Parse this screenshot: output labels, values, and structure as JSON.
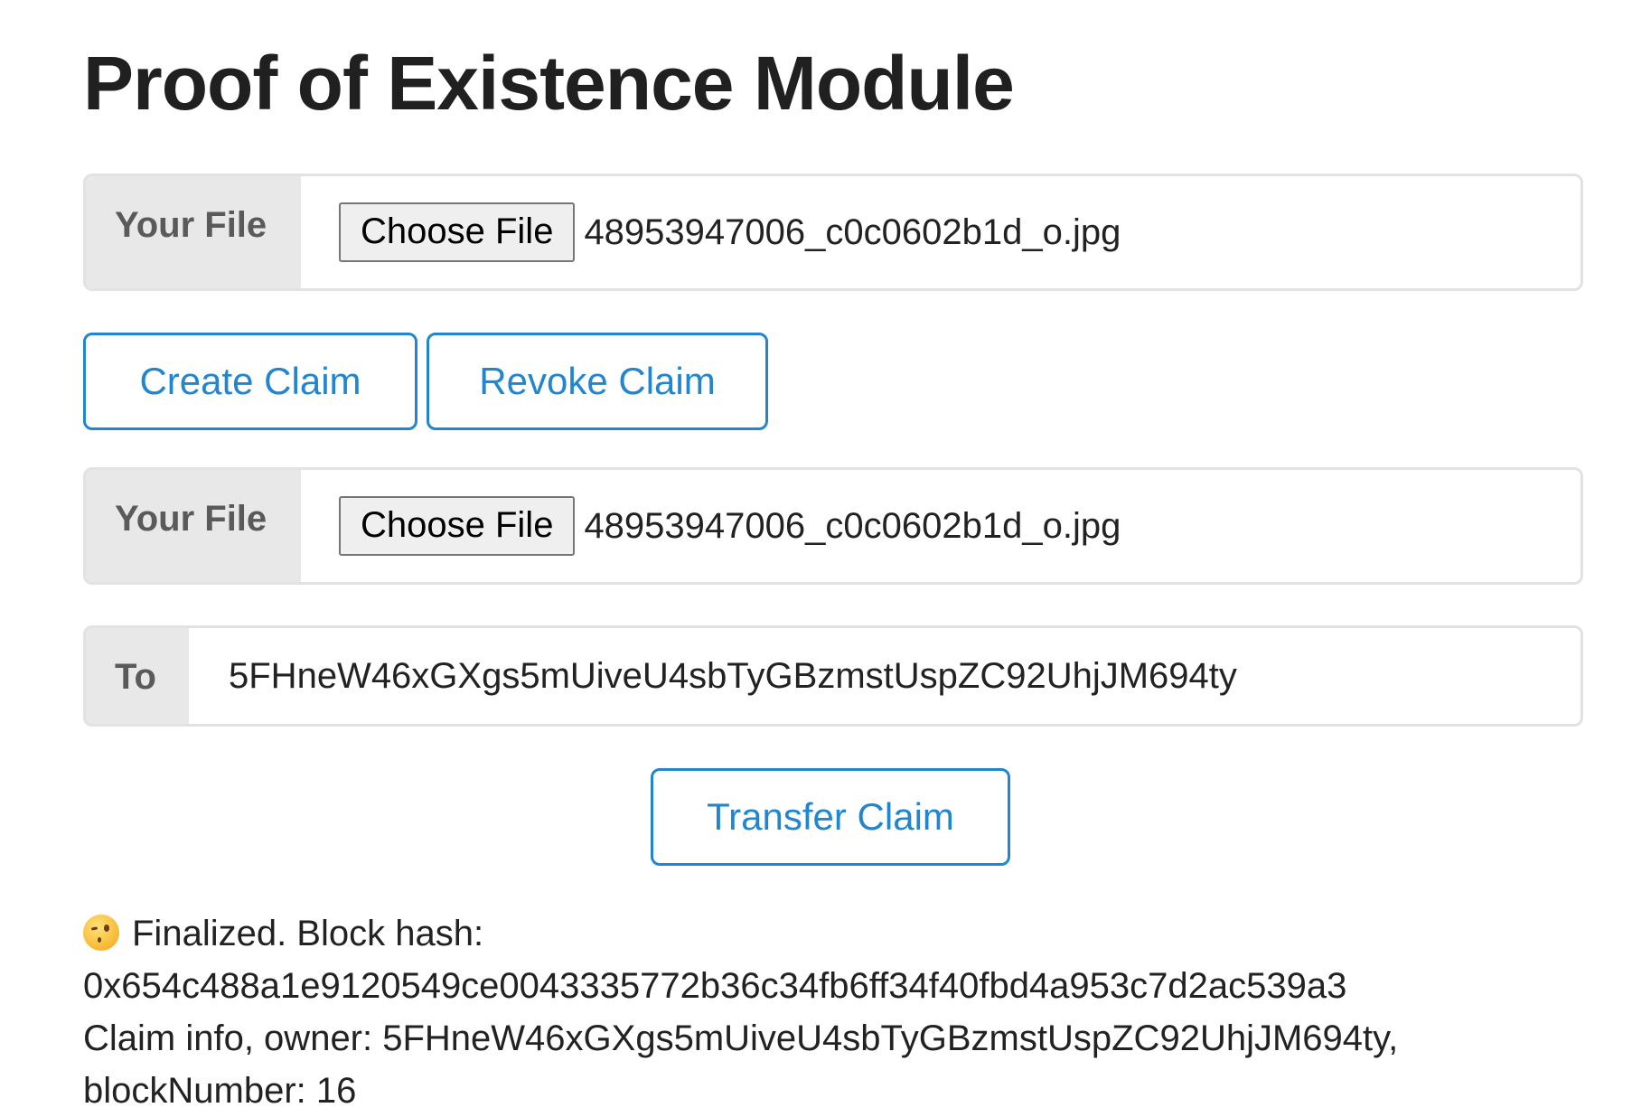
{
  "page": {
    "title": "Proof of Existence Module"
  },
  "file_field_1": {
    "label": "Your File",
    "button_label": "Choose File",
    "file_name": "48953947006_c0c0602b1d_o.jpg"
  },
  "actions": {
    "create_label": "Create Claim",
    "revoke_label": "Revoke Claim"
  },
  "file_field_2": {
    "label": "Your File",
    "button_label": "Choose File",
    "file_name": "48953947006_c0c0602b1d_o.jpg"
  },
  "to_field": {
    "label": "To",
    "value": "5FHneW46xGXgs5mUiveU4sbTyGBzmstUspZC92UhjJM694ty"
  },
  "transfer": {
    "label": "Transfer Claim"
  },
  "status": {
    "icon": "winking-face-emoji-icon",
    "line1": "Finalized. Block hash:",
    "line2": "0x654c488a1e9120549ce0043335772b36c34fb6ff34f40fbd4a953c7d2ac539a3",
    "line3": "Claim info, owner: 5FHneW46xGXgs5mUiveU4sbTyGBzmstUspZC92UhjJM694ty,",
    "line4": "blockNumber: 16"
  },
  "colors": {
    "accent": "#2185d0",
    "label_bg": "#e8e8e8",
    "border": "#e2e2e2"
  }
}
